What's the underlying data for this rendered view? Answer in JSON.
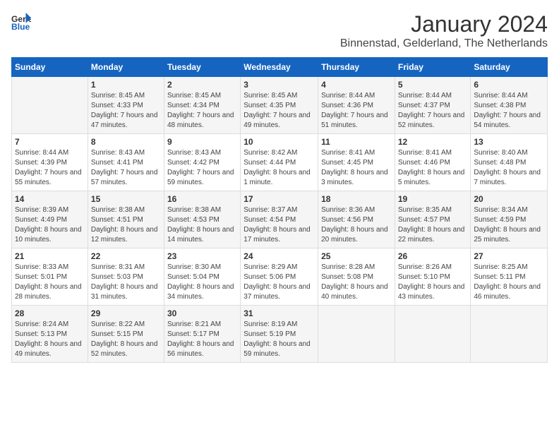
{
  "logo": {
    "general": "General",
    "blue": "Blue"
  },
  "title": "January 2024",
  "subtitle": "Binnenstad, Gelderland, The Netherlands",
  "days_of_week": [
    "Sunday",
    "Monday",
    "Tuesday",
    "Wednesday",
    "Thursday",
    "Friday",
    "Saturday"
  ],
  "weeks": [
    [
      {
        "day": "",
        "sunrise": "",
        "sunset": "",
        "daylight": ""
      },
      {
        "day": "1",
        "sunrise": "Sunrise: 8:45 AM",
        "sunset": "Sunset: 4:33 PM",
        "daylight": "Daylight: 7 hours and 47 minutes."
      },
      {
        "day": "2",
        "sunrise": "Sunrise: 8:45 AM",
        "sunset": "Sunset: 4:34 PM",
        "daylight": "Daylight: 7 hours and 48 minutes."
      },
      {
        "day": "3",
        "sunrise": "Sunrise: 8:45 AM",
        "sunset": "Sunset: 4:35 PM",
        "daylight": "Daylight: 7 hours and 49 minutes."
      },
      {
        "day": "4",
        "sunrise": "Sunrise: 8:44 AM",
        "sunset": "Sunset: 4:36 PM",
        "daylight": "Daylight: 7 hours and 51 minutes."
      },
      {
        "day": "5",
        "sunrise": "Sunrise: 8:44 AM",
        "sunset": "Sunset: 4:37 PM",
        "daylight": "Daylight: 7 hours and 52 minutes."
      },
      {
        "day": "6",
        "sunrise": "Sunrise: 8:44 AM",
        "sunset": "Sunset: 4:38 PM",
        "daylight": "Daylight: 7 hours and 54 minutes."
      }
    ],
    [
      {
        "day": "7",
        "sunrise": "Sunrise: 8:44 AM",
        "sunset": "Sunset: 4:39 PM",
        "daylight": "Daylight: 7 hours and 55 minutes."
      },
      {
        "day": "8",
        "sunrise": "Sunrise: 8:43 AM",
        "sunset": "Sunset: 4:41 PM",
        "daylight": "Daylight: 7 hours and 57 minutes."
      },
      {
        "day": "9",
        "sunrise": "Sunrise: 8:43 AM",
        "sunset": "Sunset: 4:42 PM",
        "daylight": "Daylight: 7 hours and 59 minutes."
      },
      {
        "day": "10",
        "sunrise": "Sunrise: 8:42 AM",
        "sunset": "Sunset: 4:44 PM",
        "daylight": "Daylight: 8 hours and 1 minute."
      },
      {
        "day": "11",
        "sunrise": "Sunrise: 8:41 AM",
        "sunset": "Sunset: 4:45 PM",
        "daylight": "Daylight: 8 hours and 3 minutes."
      },
      {
        "day": "12",
        "sunrise": "Sunrise: 8:41 AM",
        "sunset": "Sunset: 4:46 PM",
        "daylight": "Daylight: 8 hours and 5 minutes."
      },
      {
        "day": "13",
        "sunrise": "Sunrise: 8:40 AM",
        "sunset": "Sunset: 4:48 PM",
        "daylight": "Daylight: 8 hours and 7 minutes."
      }
    ],
    [
      {
        "day": "14",
        "sunrise": "Sunrise: 8:39 AM",
        "sunset": "Sunset: 4:49 PM",
        "daylight": "Daylight: 8 hours and 10 minutes."
      },
      {
        "day": "15",
        "sunrise": "Sunrise: 8:38 AM",
        "sunset": "Sunset: 4:51 PM",
        "daylight": "Daylight: 8 hours and 12 minutes."
      },
      {
        "day": "16",
        "sunrise": "Sunrise: 8:38 AM",
        "sunset": "Sunset: 4:53 PM",
        "daylight": "Daylight: 8 hours and 14 minutes."
      },
      {
        "day": "17",
        "sunrise": "Sunrise: 8:37 AM",
        "sunset": "Sunset: 4:54 PM",
        "daylight": "Daylight: 8 hours and 17 minutes."
      },
      {
        "day": "18",
        "sunrise": "Sunrise: 8:36 AM",
        "sunset": "Sunset: 4:56 PM",
        "daylight": "Daylight: 8 hours and 20 minutes."
      },
      {
        "day": "19",
        "sunrise": "Sunrise: 8:35 AM",
        "sunset": "Sunset: 4:57 PM",
        "daylight": "Daylight: 8 hours and 22 minutes."
      },
      {
        "day": "20",
        "sunrise": "Sunrise: 8:34 AM",
        "sunset": "Sunset: 4:59 PM",
        "daylight": "Daylight: 8 hours and 25 minutes."
      }
    ],
    [
      {
        "day": "21",
        "sunrise": "Sunrise: 8:33 AM",
        "sunset": "Sunset: 5:01 PM",
        "daylight": "Daylight: 8 hours and 28 minutes."
      },
      {
        "day": "22",
        "sunrise": "Sunrise: 8:31 AM",
        "sunset": "Sunset: 5:03 PM",
        "daylight": "Daylight: 8 hours and 31 minutes."
      },
      {
        "day": "23",
        "sunrise": "Sunrise: 8:30 AM",
        "sunset": "Sunset: 5:04 PM",
        "daylight": "Daylight: 8 hours and 34 minutes."
      },
      {
        "day": "24",
        "sunrise": "Sunrise: 8:29 AM",
        "sunset": "Sunset: 5:06 PM",
        "daylight": "Daylight: 8 hours and 37 minutes."
      },
      {
        "day": "25",
        "sunrise": "Sunrise: 8:28 AM",
        "sunset": "Sunset: 5:08 PM",
        "daylight": "Daylight: 8 hours and 40 minutes."
      },
      {
        "day": "26",
        "sunrise": "Sunrise: 8:26 AM",
        "sunset": "Sunset: 5:10 PM",
        "daylight": "Daylight: 8 hours and 43 minutes."
      },
      {
        "day": "27",
        "sunrise": "Sunrise: 8:25 AM",
        "sunset": "Sunset: 5:11 PM",
        "daylight": "Daylight: 8 hours and 46 minutes."
      }
    ],
    [
      {
        "day": "28",
        "sunrise": "Sunrise: 8:24 AM",
        "sunset": "Sunset: 5:13 PM",
        "daylight": "Daylight: 8 hours and 49 minutes."
      },
      {
        "day": "29",
        "sunrise": "Sunrise: 8:22 AM",
        "sunset": "Sunset: 5:15 PM",
        "daylight": "Daylight: 8 hours and 52 minutes."
      },
      {
        "day": "30",
        "sunrise": "Sunrise: 8:21 AM",
        "sunset": "Sunset: 5:17 PM",
        "daylight": "Daylight: 8 hours and 56 minutes."
      },
      {
        "day": "31",
        "sunrise": "Sunrise: 8:19 AM",
        "sunset": "Sunset: 5:19 PM",
        "daylight": "Daylight: 8 hours and 59 minutes."
      },
      {
        "day": "",
        "sunrise": "",
        "sunset": "",
        "daylight": ""
      },
      {
        "day": "",
        "sunrise": "",
        "sunset": "",
        "daylight": ""
      },
      {
        "day": "",
        "sunrise": "",
        "sunset": "",
        "daylight": ""
      }
    ]
  ]
}
